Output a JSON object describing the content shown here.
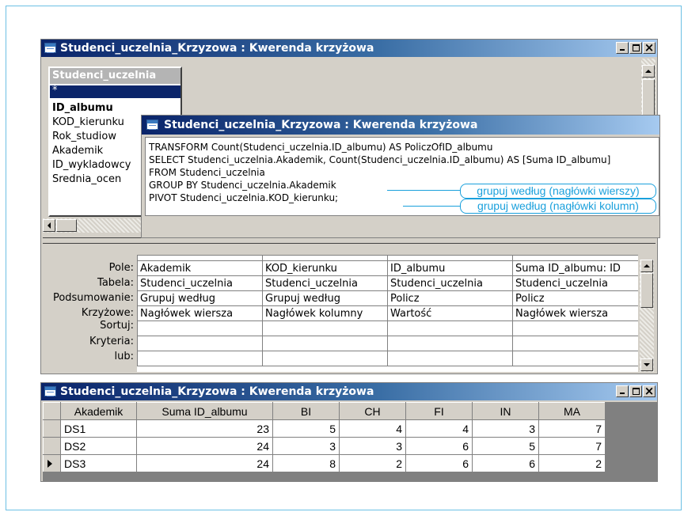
{
  "design_window": {
    "title": "Studenci_uczelnia_Krzyzowa : Kwerenda krzyżowa",
    "table_box": {
      "name": "Studenci_uczelnia",
      "fields": [
        "*",
        "ID_albumu",
        "KOD_kierunku",
        "Rok_studiow",
        "Akademik",
        "ID_wykladowcy",
        "Srednia_ocen"
      ]
    },
    "grid": {
      "row_labels": [
        "Pole:",
        "Tabela:",
        "Podsumowanie:",
        "Krzyżowe:",
        "Sortuj:",
        "Kryteria:",
        "lub:"
      ],
      "columns": [
        [
          "Akademik",
          "Studenci_uczelnia",
          "Grupuj według",
          "Nagłówek wiersza",
          "",
          "",
          ""
        ],
        [
          "KOD_kierunku",
          "Studenci_uczelnia",
          "Grupuj według",
          "Nagłówek kolumny",
          "",
          "",
          ""
        ],
        [
          "ID_albumu",
          "Studenci_uczelnia",
          "Policz",
          "Wartość",
          "",
          "",
          ""
        ],
        [
          "Suma ID_albumu: ID",
          "Studenci_uczelnia",
          "Policz",
          "Nagłówek wiersza",
          "",
          "",
          ""
        ]
      ]
    }
  },
  "sql_window": {
    "title": "Studenci_uczelnia_Krzyzowa : Kwerenda krzyżowa",
    "lines": [
      "TRANSFORM Count(Studenci_uczelnia.ID_albumu) AS PoliczOfID_albumu",
      "SELECT Studenci_uczelnia.Akademik, Count(Studenci_uczelnia.ID_albumu) AS [Suma ID_albumu]",
      "FROM Studenci_uczelnia",
      "GROUP BY Studenci_uczelnia.Akademik",
      "PIVOT Studenci_uczelnia.KOD_kierunku;"
    ]
  },
  "annotations": {
    "rows": "grupuj według (nagłówki wierszy)",
    "cols": "grupuj według (nagłówki kolumn)",
    "color": "#1aa0dc"
  },
  "result_window": {
    "title": "Studenci_uczelnia_Krzyzowa : Kwerenda krzyżowa",
    "headers": [
      "Akademik",
      "Suma ID_albumu",
      "BI",
      "CH",
      "FI",
      "IN",
      "MA"
    ],
    "rows": [
      [
        "DS1",
        "23",
        "5",
        "4",
        "4",
        "3",
        "7"
      ],
      [
        "DS2",
        "24",
        "3",
        "3",
        "6",
        "5",
        "7"
      ],
      [
        "DS3",
        "24",
        "8",
        "2",
        "6",
        "6",
        "2"
      ]
    ],
    "current_row": 2
  },
  "colors": {
    "titlebar_start": "#0a246a",
    "titlebar_end": "#a6caf0",
    "window_face": "#d4d0c8"
  }
}
